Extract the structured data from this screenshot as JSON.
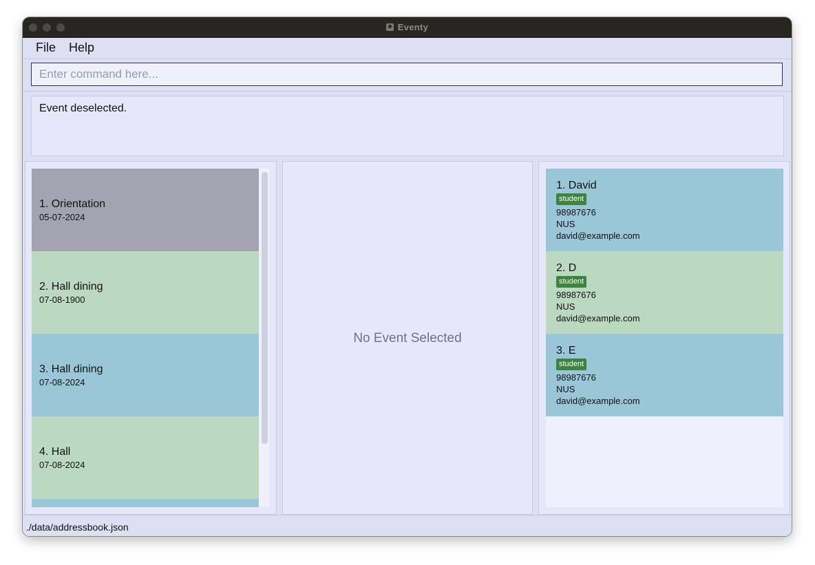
{
  "window": {
    "title": "Eventy"
  },
  "menu": {
    "file_label": "File",
    "help_label": "Help"
  },
  "command": {
    "placeholder": "Enter command here...",
    "value": ""
  },
  "result": {
    "message": "Event deselected."
  },
  "events": [
    {
      "index": "1.",
      "name": "Orientation",
      "date": "05-07-2024",
      "color": "#a4a3b1"
    },
    {
      "index": "2.",
      "name": "Hall dining",
      "date": "07-08-1900",
      "color": "#bbd8c1"
    },
    {
      "index": "3.",
      "name": "Hall dining",
      "date": "07-08-2024",
      "color": "#9ac7d8"
    },
    {
      "index": "4.",
      "name": "Hall",
      "date": "07-08-2024",
      "color": "#bbd8c1"
    }
  ],
  "event_detail": {
    "empty_text": "No Event Selected"
  },
  "contacts": [
    {
      "index": "1.",
      "name": "David",
      "tag": "student",
      "phone": "98987676",
      "address": "NUS",
      "email": "david@example.com",
      "color": "#9ac7d8"
    },
    {
      "index": "2.",
      "name": "D",
      "tag": "student",
      "phone": "98987676",
      "address": "NUS",
      "email": "david@example.com",
      "color": "#bbd8c1"
    },
    {
      "index": "3.",
      "name": "E",
      "tag": "student",
      "phone": "98987676",
      "address": "NUS",
      "email": "david@example.com",
      "color": "#9ac7d8"
    }
  ],
  "status": {
    "path": "./data/addressbook.json"
  },
  "colors": {
    "tag_bg": "#3c843f",
    "window_bg": "#dedff3",
    "panel_bg": "#e6e7fb"
  }
}
